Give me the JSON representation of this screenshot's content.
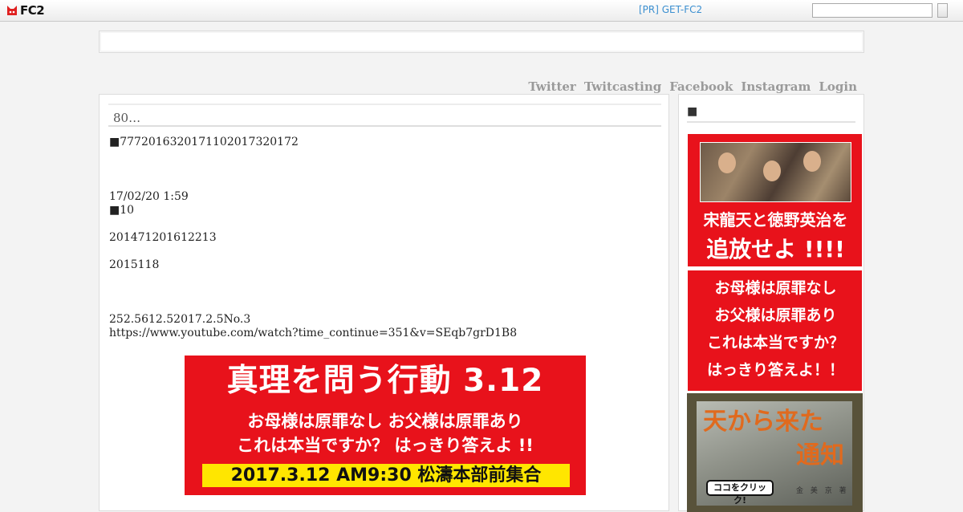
{
  "topbar": {
    "logo_text": "FC2",
    "pr_link": "[PR] GET-FC2",
    "search_placeholder": "",
    "search_button": ""
  },
  "nav": {
    "items": [
      "Twitter",
      "Twitcasting",
      "Facebook",
      "Instagram",
      "Login"
    ]
  },
  "post": {
    "title": "80…",
    "lines": [
      "■7772016320171102017320172",
      "",
      "",
      "",
      "17/02/20 1:59",
      "■10",
      "",
      "201471201612213",
      "",
      "2015118",
      "",
      "",
      "",
      "252.5612.52017.2.5No.3",
      "https://www.youtube.com/watch?time_continue=351&v=SEqb7grD1B8"
    ],
    "banner": {
      "headline": "真理を問う行動 3.12",
      "line2": "お母様は原罪なし お父様は原罪あり",
      "line3": "これは本当ですか？ はっきり答えよ !!",
      "date_bar": "2017.3.12 AM9:30 松濤本部前集合",
      "bg_color": "#e8121b",
      "bar_color": "#ffe600"
    }
  },
  "sidebar": {
    "title": "■",
    "banner1": {
      "line1": "宋龍天と徳野英治を",
      "line2": "追放せよ !!!!"
    },
    "banner2": {
      "lines": [
        "お母様は原罪なし",
        "お父様は原罪あり",
        "これは本当ですか？",
        "はっきり答えよ！！"
      ]
    },
    "banner3": {
      "line1": "天から来た",
      "line2": "通知",
      "button": "ココをクリック!",
      "author": "金 美 京 著"
    }
  },
  "colors": {
    "accent_link": "#3b8fd0",
    "nav_text": "#9a9a9a",
    "banner_red": "#e8121b"
  }
}
